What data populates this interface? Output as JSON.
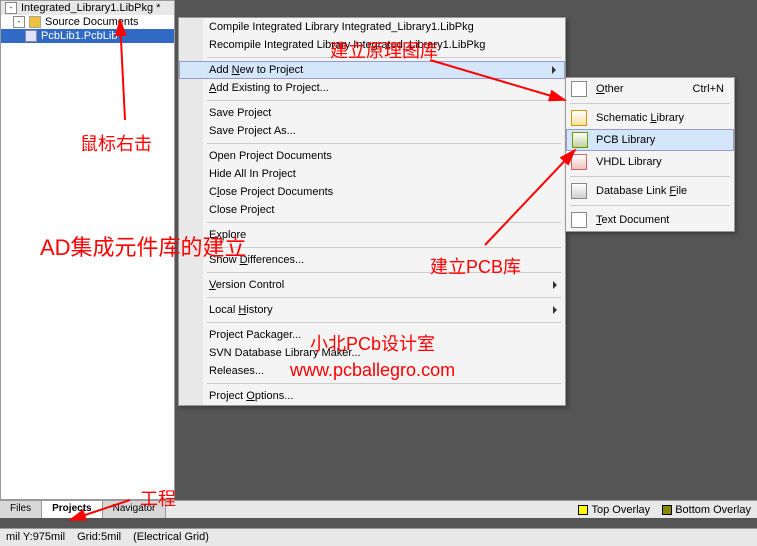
{
  "tree": {
    "root": "Integrated_Library1.LibPkg *",
    "folder": "Source Documents",
    "file": "PcbLib1.PcbLib"
  },
  "menu": {
    "compile": "Compile Integrated Library Integrated_Library1.LibPkg",
    "recompile": "Recompile Integrated Library Integrated_Library1.LibPkg",
    "add_new": "Add New to Project",
    "add_existing": "Add Existing to Project...",
    "save": "Save Project",
    "save_as": "Save Project As...",
    "open_docs": "Open Project Documents",
    "hide_all": "Hide All In Project",
    "close_docs": "Close Project Documents",
    "close": "Close Project",
    "explore": "Explore",
    "show_diff": "Show Differences...",
    "version": "Version Control",
    "history": "Local History",
    "packager": "Project Packager...",
    "svn": "SVN Database Library Maker...",
    "releases": "Releases...",
    "options": "Project Options..."
  },
  "submenu": {
    "other": "Other",
    "other_shortcut": "Ctrl+N",
    "schematic": "Schematic Library",
    "pcb": "PCB Library",
    "vhdl": "VHDL Library",
    "database": "Database Link File",
    "text": "Text Document"
  },
  "tabs": {
    "files": "Files",
    "projects": "Projects",
    "navigator": "Navigator"
  },
  "layers": {
    "top_overlay": "Top Overlay",
    "bottom_overlay": "Bottom Overlay"
  },
  "status": {
    "coords": "mil Y:975mil",
    "grid": "Grid:5mil",
    "egrid": "(Electrical Grid)"
  },
  "annotations": {
    "title": "AD集成元件库的建立",
    "build_sch": "建立原理图库",
    "build_pcb": "建立PCB库",
    "right_click": "鼠标右击",
    "project": "工程",
    "studio": "小北PCb设计室",
    "website": "www.pcballegro.com"
  }
}
